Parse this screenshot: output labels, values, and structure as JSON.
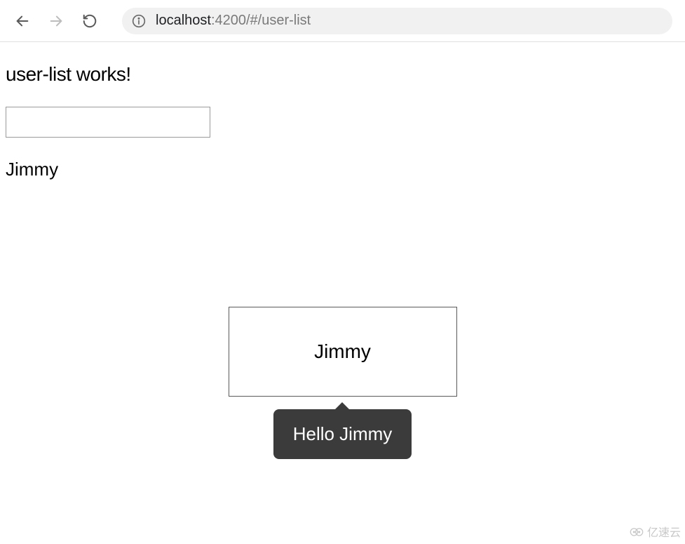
{
  "browser": {
    "url_host": "localhost",
    "url_path": ":4200/#/user-list"
  },
  "page": {
    "heading": "user-list works!",
    "input_value": "",
    "username": "Jimmy"
  },
  "card": {
    "title": "Jimmy",
    "tooltip": "Hello Jimmy"
  },
  "watermark": {
    "text": "亿速云"
  }
}
